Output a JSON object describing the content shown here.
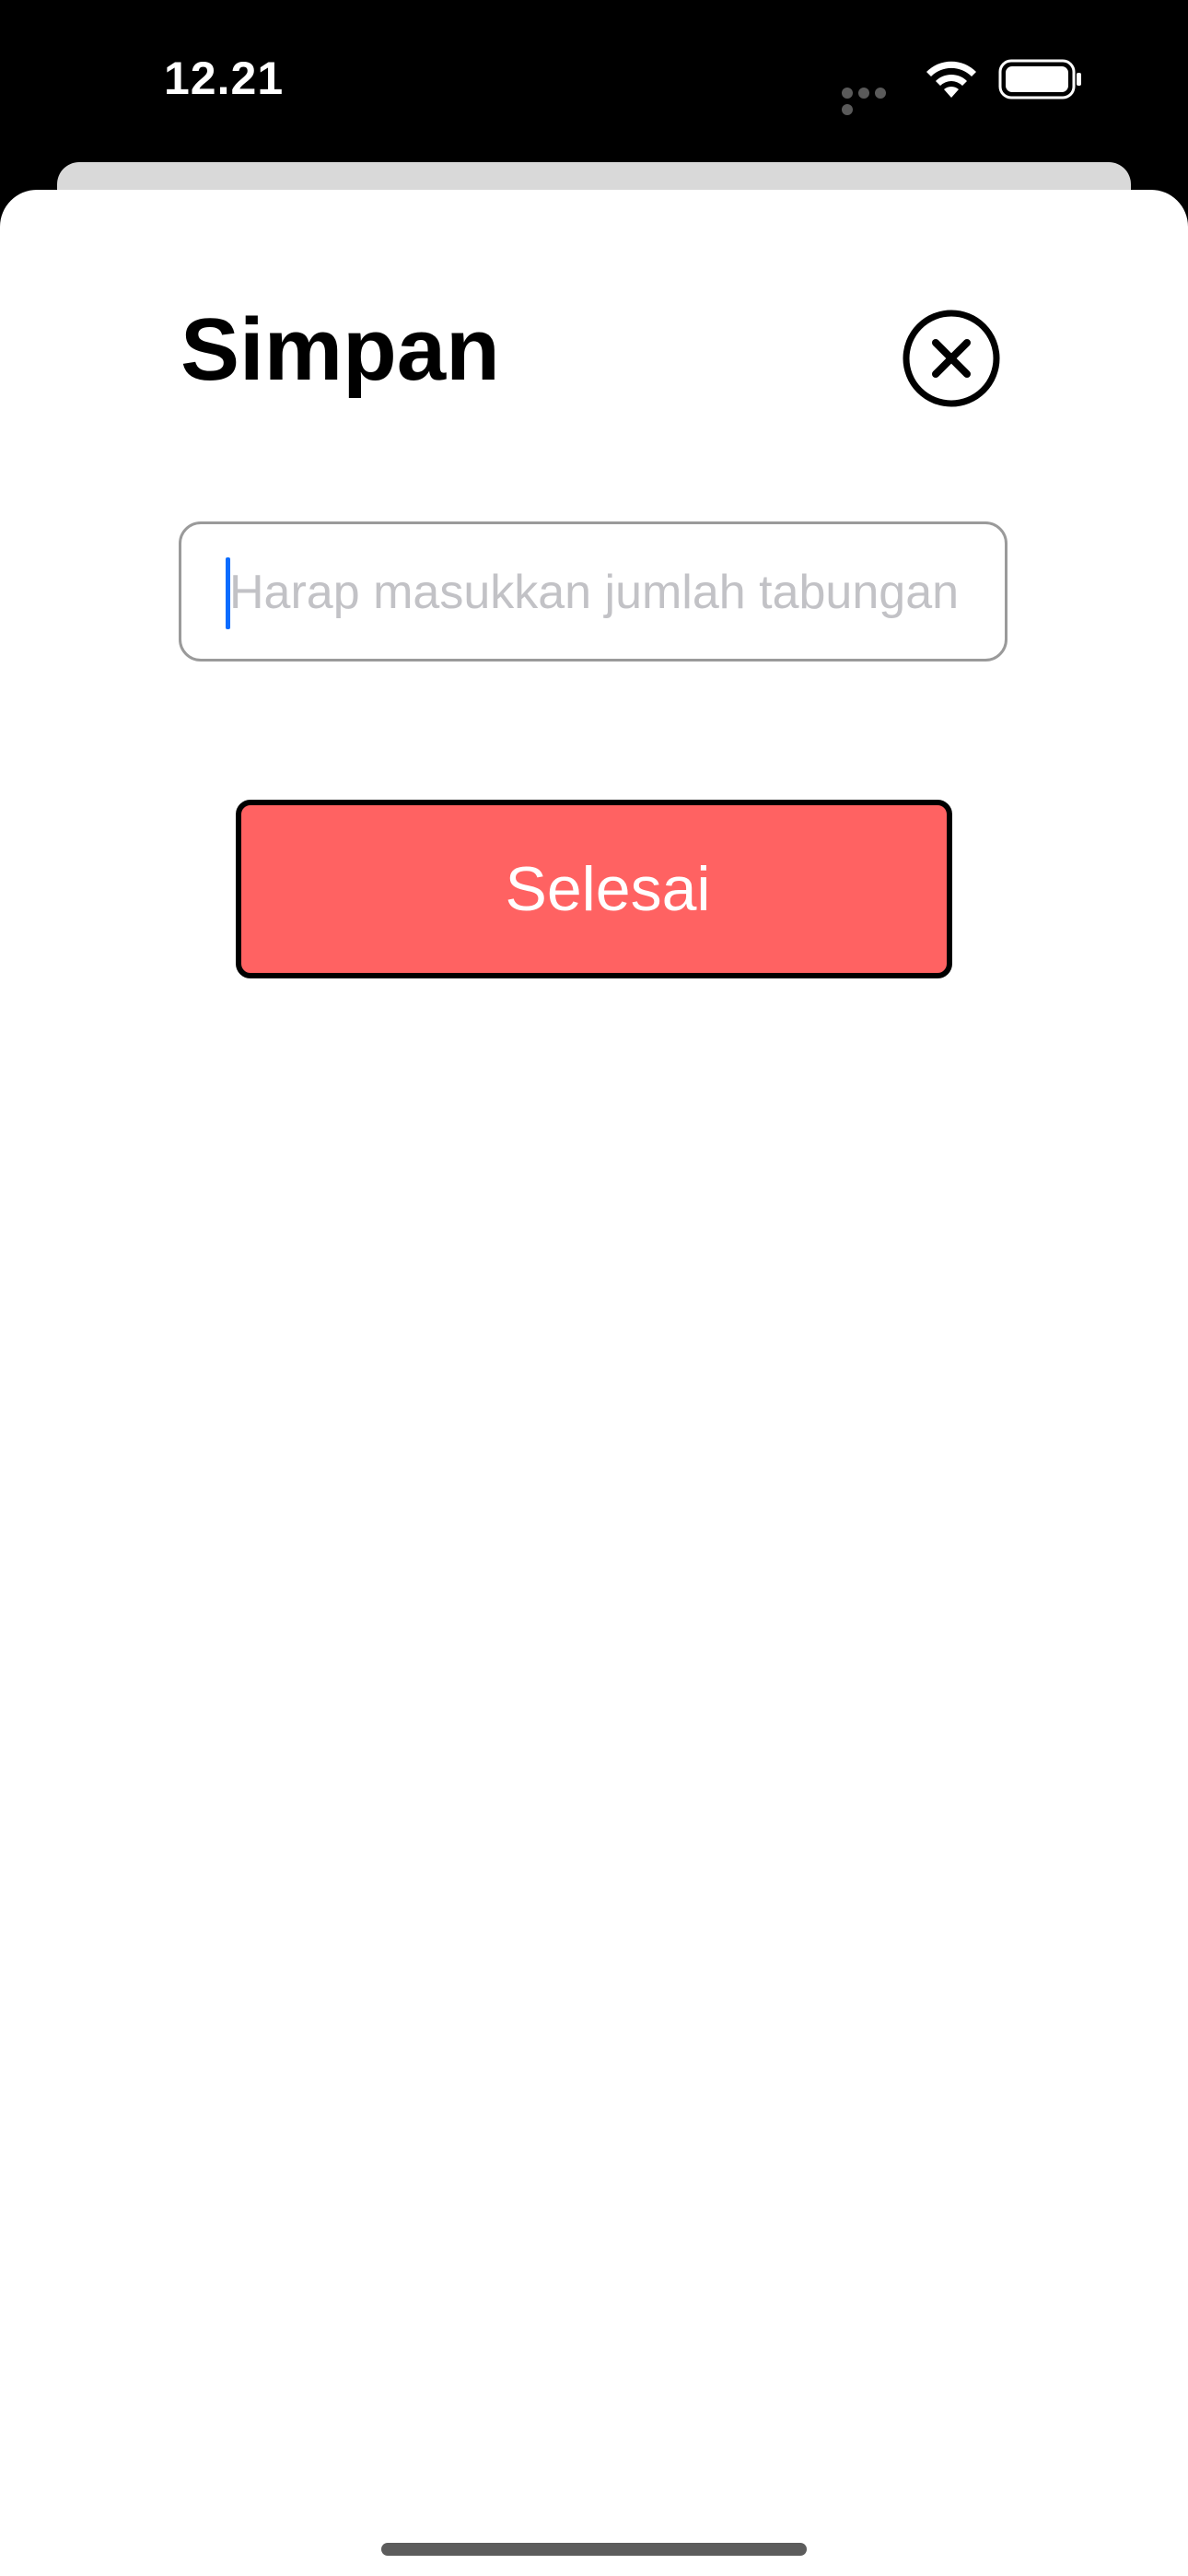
{
  "status_bar": {
    "time": "12.21",
    "icons": [
      "signal-dots-icon",
      "wifi-icon",
      "battery-icon"
    ]
  },
  "sheet": {
    "title": "Simpan",
    "close_icon": "close-circle-icon",
    "amount_input": {
      "value": "",
      "placeholder": "Harap masukkan jumlah tabungan",
      "focused": true
    },
    "done_button": {
      "label": "Selesai"
    }
  },
  "colors": {
    "accent_button": "#ff6262",
    "caret": "#0a6cff",
    "placeholder": "#c2c2c6",
    "background": "#ffffff",
    "status_bar": "#000000"
  }
}
